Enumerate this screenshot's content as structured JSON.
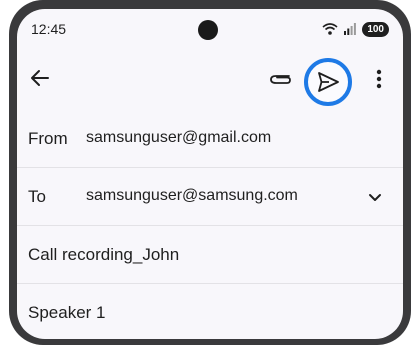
{
  "status_bar": {
    "time": "12:45",
    "battery": "100",
    "icons": [
      "wifi-calling-icon",
      "signal-icon",
      "battery-icon"
    ]
  },
  "toolbar": {
    "icons": [
      "arrow-back-icon",
      "paperclip-icon",
      "send-icon",
      "more-vert-icon"
    ],
    "highlight_color": "#1e7ae6"
  },
  "compose": {
    "from_label": "From",
    "from_value": "samsunguser@gmail.com",
    "to_label": "To",
    "to_value": "samsunguser@samsung.com",
    "subject": "Call recording_John",
    "body": "Speaker 1"
  }
}
